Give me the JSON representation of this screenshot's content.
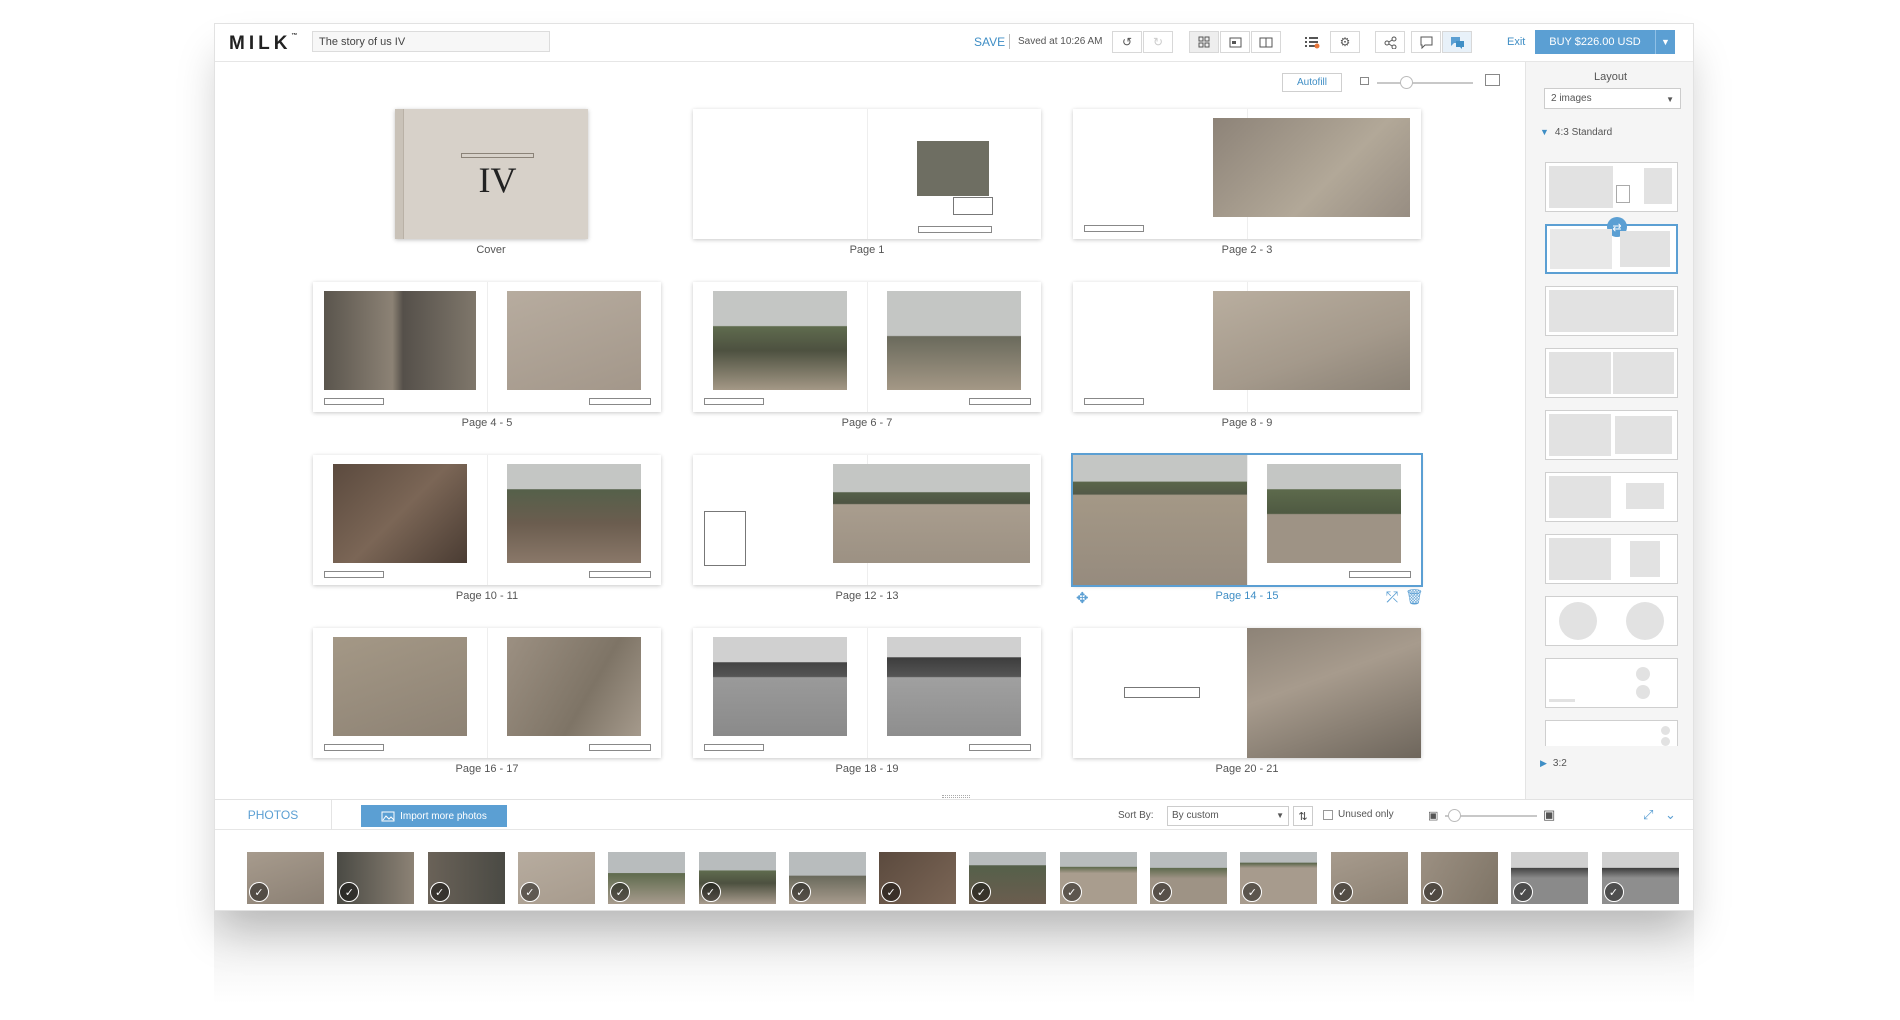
{
  "app": {
    "logo": "MILK",
    "logo_tm": "™",
    "project_title": "The story of us IV",
    "save_label": "SAVE",
    "saved_status": "Saved at 10:26 AM",
    "exit_label": "Exit",
    "buy_label": "BUY $226.00 USD"
  },
  "toolbar_icons": [
    "undo-icon",
    "redo-icon",
    "grid-view-icon",
    "page-view-icon",
    "spread-view-icon",
    "checklist-icon",
    "settings-icon",
    "share-icon",
    "comment-icon",
    "chat-icon"
  ],
  "editor": {
    "autofill_label": "Autofill",
    "zoom_level": 0.3,
    "cover_text": "IV",
    "pages": [
      {
        "label": "Cover"
      },
      {
        "label": "Page 1"
      },
      {
        "label": "Page 2 - 3"
      },
      {
        "label": "Page 4 - 5"
      },
      {
        "label": "Page 6 - 7"
      },
      {
        "label": "Page 8 - 9"
      },
      {
        "label": "Page 10 - 11"
      },
      {
        "label": "Page 12 - 13"
      },
      {
        "label": "Page 14 - 15",
        "selected": true
      },
      {
        "label": "Page 16 - 17"
      },
      {
        "label": "Page 18 - 19"
      },
      {
        "label": "Page 20 - 21"
      }
    ]
  },
  "layout_panel": {
    "title": "Layout",
    "selected_option": "2 images",
    "section_expanded": "4:3 Standard",
    "section_collapsed": "3:2",
    "selected_index": 1
  },
  "photos_bar": {
    "tab_label": "PHOTOS",
    "import_label": "Import more photos",
    "sort_label": "Sort By:",
    "sort_value": "By custom",
    "unused_label": "Unused only",
    "thumb_size": 0.1,
    "photo_count": 16,
    "check_glyph": "✓"
  },
  "colors": {
    "accent": "#5b9fd3",
    "link": "#3f8ec5",
    "photo_sand": "#a79b8d",
    "photo_dark": "#4a4a44",
    "photo_sky": "#b8bcbd",
    "photo_green": "#5f6b4e"
  }
}
